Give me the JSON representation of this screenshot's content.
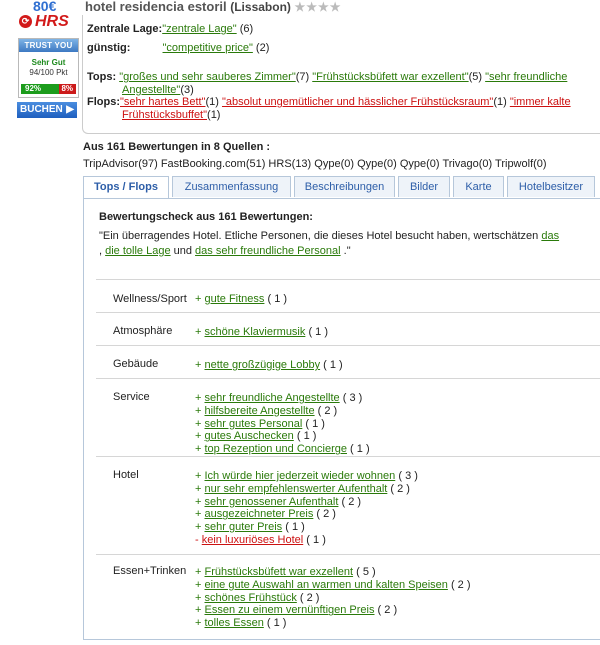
{
  "sidebar": {
    "price": "80€",
    "hrs_logo": "HRS",
    "trust_title": "TRUST YOU",
    "trust_rating": "Sehr Gut",
    "trust_score": "94/100 Pkt",
    "trust_pos": "92%",
    "trust_neg": "8%",
    "book_label": "BUCHEN",
    "colors": {
      "price": "#2f6fd1",
      "hrs": "#d21a1a",
      "good": "#1c9c1c",
      "bad": "#cc1b1b"
    }
  },
  "hotel": {
    "name": "hotel residencia estoril",
    "city": "(Lissabon)",
    "stars": "★★★★"
  },
  "summary": {
    "lage_label": "Zentrale Lage:",
    "lage_value": "\"zentrale Lage\"",
    "lage_count": "(6)",
    "preis_label": "günstig:",
    "preis_value": "\"competitive price\"",
    "preis_count": "(2)",
    "tops_label": "Tops:",
    "tops": [
      {
        "text": "\"großes und sehr sauberes Zimmer\"",
        "count": "(7)"
      },
      {
        "text": "\"Frühstücksbüfett war exzellent\"",
        "count": "(5)"
      },
      {
        "text": "\"sehr freundliche",
        "count": ""
      }
    ],
    "tops_line2_text": "Angestellte\"",
    "tops_line2_count": "(3)",
    "flops_label": "Flops:",
    "flops": [
      {
        "text": "\"sehr hartes Bett\"",
        "count": "(1)"
      },
      {
        "text": "\"absolut ungemütlicher und hässlicher Frühstücksraum\"",
        "count": "(1)"
      },
      {
        "text": "\"immer kalte",
        "count": ""
      }
    ],
    "flops_line2_text": "Frühstücksbuffet\"",
    "flops_line2_count": "(1)"
  },
  "reviews": {
    "heading": "Aus 161 Bewertungen in 8 Quellen :",
    "sources": "TripAdvisor(97)  FastBooking.com(51)  HRS(13)  Qype(0)  Qype(0)  Qype(0)  Trivago(0)  Tripwolf(0)"
  },
  "tabs": [
    {
      "label": "Tops / Flops",
      "active": true
    },
    {
      "label": "Zusammenfassung"
    },
    {
      "label": "Beschreibungen"
    },
    {
      "label": "Bilder"
    },
    {
      "label": "Karte"
    },
    {
      "label": "Hotelbesitzer"
    }
  ],
  "panel": {
    "title": "Bewertungscheck aus 161 Bewertungen:",
    "quote_start": "\"Ein überragendes Hotel. Etliche Personen, die dieses Hotel besucht haben, wertschätzen ",
    "quote_link1": "das",
    "quote_line2_pre": ", ",
    "quote_link2": "die tolle Lage",
    "quote_mid": " und ",
    "quote_link3": "das sehr freundliche Personal",
    "quote_end": " .\""
  },
  "categories": [
    {
      "name": "Wellness/Sport",
      "items": [
        {
          "sign": "+",
          "text": "gute Fitness",
          "count": "( 1 )"
        }
      ]
    },
    {
      "name": "Atmosphäre",
      "items": [
        {
          "sign": "+",
          "text": "schöne Klaviermusik",
          "count": "( 1 )"
        }
      ]
    },
    {
      "name": "Gebäude",
      "items": [
        {
          "sign": "+",
          "text": "nette großzügige Lobby",
          "count": "( 1 )"
        }
      ]
    },
    {
      "name": "Service",
      "items": [
        {
          "sign": "+",
          "text": "sehr freundliche Angestellte",
          "count": "( 3 )"
        },
        {
          "sign": "+",
          "text": "hilfsbereite Angestellte",
          "count": "( 2 )"
        },
        {
          "sign": "+",
          "text": "sehr gutes Personal",
          "count": "( 1 )"
        },
        {
          "sign": "+",
          "text": "gutes Auschecken",
          "count": "( 1 )"
        },
        {
          "sign": "+",
          "text": "top Rezeption und Concierge",
          "count": "( 1 )"
        }
      ]
    },
    {
      "name": "Hotel",
      "items": [
        {
          "sign": "+",
          "text": "Ich würde hier jederzeit wieder wohnen",
          "count": "( 3 )"
        },
        {
          "sign": "+",
          "text": "nur sehr empfehlenswerter Aufenthalt",
          "count": "( 2 )"
        },
        {
          "sign": "+",
          "text": "sehr genossener Aufenthalt",
          "count": "( 2 )"
        },
        {
          "sign": "+",
          "text": "ausgezeichneter Preis",
          "count": "( 2 )"
        },
        {
          "sign": "+",
          "text": "sehr guter Preis",
          "count": "( 1 )"
        },
        {
          "sign": "-",
          "text": "kein luxuriöses Hotel",
          "count": "( 1 )"
        }
      ]
    },
    {
      "name": "Essen+Trinken",
      "items": [
        {
          "sign": "+",
          "text": "Frühstücksbüfett war exzellent",
          "count": "( 5 )"
        },
        {
          "sign": "+",
          "text": "eine gute Auswahl an warmen und kalten Speisen",
          "count": "( 2 )"
        },
        {
          "sign": "+",
          "text": "schönes Frühstück",
          "count": "( 2 )"
        },
        {
          "sign": "+",
          "text": "Essen zu einem vernünftigen Preis",
          "count": "( 2 )"
        },
        {
          "sign": "+",
          "text": "tolles Essen",
          "count": "( 1 )"
        }
      ]
    }
  ]
}
